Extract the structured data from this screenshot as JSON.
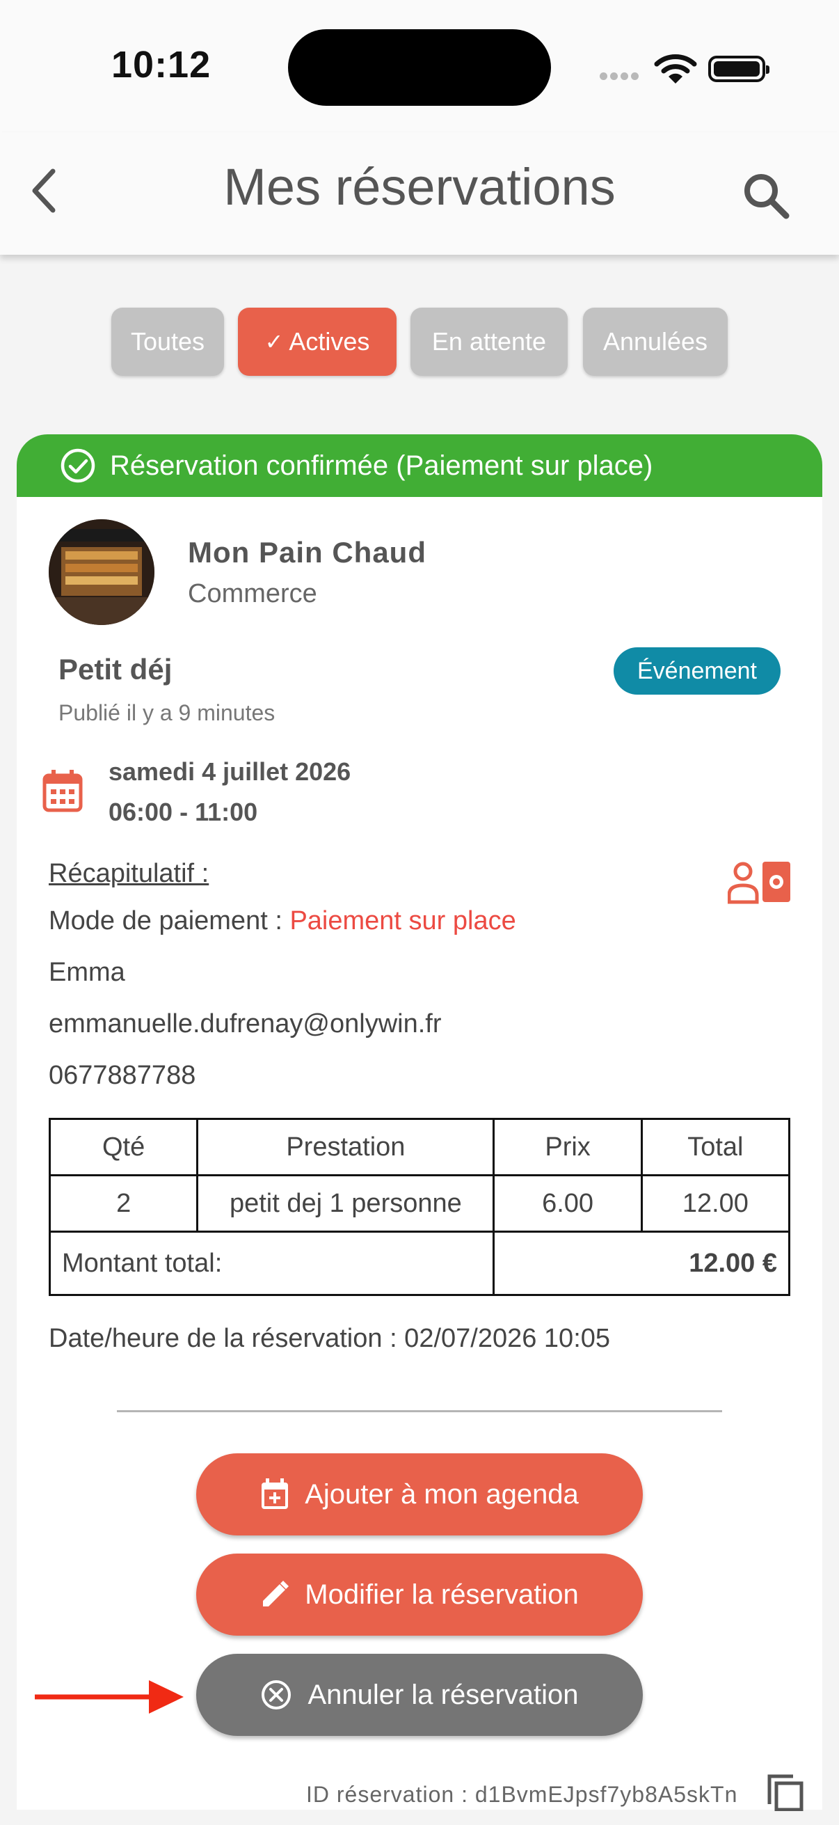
{
  "status_bar": {
    "time": "10:12"
  },
  "header": {
    "title": "Mes réservations"
  },
  "filters": [
    {
      "label": "Toutes",
      "active": false
    },
    {
      "label": "Actives",
      "active": true
    },
    {
      "label": "En attente",
      "active": false
    },
    {
      "label": "Annulées",
      "active": false
    }
  ],
  "reservation": {
    "status_banner": "Réservation confirmée (Paiement sur place)",
    "shop": {
      "name": "Mon Pain Chaud",
      "type": "Commerce"
    },
    "offer": {
      "title": "Petit déj",
      "published": "Publié il y a 9 minutes",
      "badge": "Événement"
    },
    "date": {
      "day": "samedi 4 juillet 2026",
      "hours": "06:00 - 11:00"
    },
    "recap": {
      "heading": "Récapitulatif :",
      "payment_label": "Mode de paiement : ",
      "payment_value": "Paiement sur place",
      "name": "Emma",
      "email": "emmanuelle.dufrenay@onlywin.fr",
      "phone": "0677887788"
    },
    "table": {
      "headers": [
        "Qté",
        "Prestation",
        "Prix",
        "Total"
      ],
      "rows": [
        {
          "qty": "2",
          "item": "petit dej 1 personne",
          "price": "6.00",
          "total": "12.00"
        }
      ],
      "total_label": "Montant total:",
      "total_value": "12.00 €"
    },
    "booked_at": "Date/heure de la réservation : 02/07/2026 10:05",
    "actions": {
      "agenda": "Ajouter à mon agenda",
      "edit": "Modifier la réservation",
      "cancel": "Annuler la réservation"
    },
    "id_text": "ID réservation : d1BvmEJpsf7yb8A5skTn"
  },
  "colors": {
    "accent": "#e8614b",
    "confirmed": "#41ae35",
    "badge": "#108ba6",
    "payment_text": "#ec4a42",
    "cancel_button": "#757575",
    "annotation_arrow": "#f02a14"
  },
  "icons": [
    "back-icon",
    "search-icon",
    "check-circle-icon",
    "calendar-icon",
    "id-card-icon",
    "calendar-plus-icon",
    "pencil-icon",
    "cancel-circle-icon",
    "copy-icon"
  ]
}
